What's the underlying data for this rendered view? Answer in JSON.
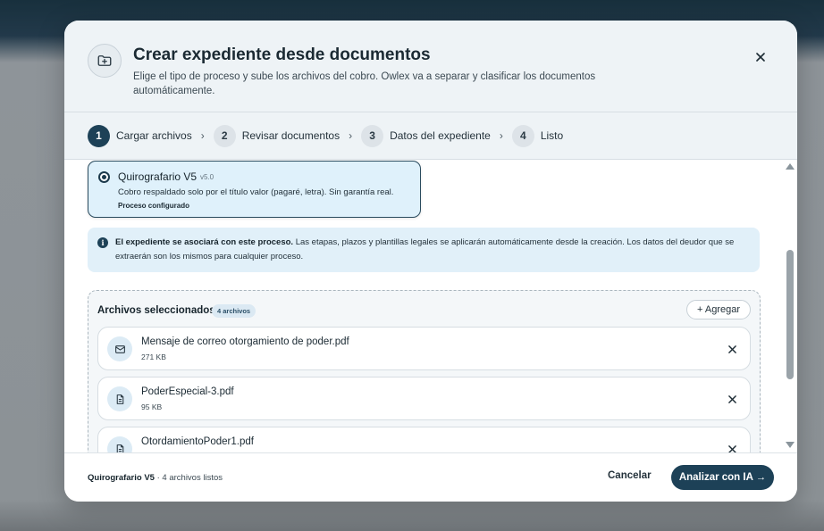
{
  "header": {
    "title": "Crear expediente desde documentos",
    "subtitle": "Elige el tipo de proceso y sube los archivos del cobro. Owlex va a separar y clasificar los documentos automáticamente.",
    "close_icon": "close-icon",
    "folder_icon": "folder-plus-icon"
  },
  "steps": [
    {
      "num": "1",
      "label": "Cargar archivos",
      "active": true
    },
    {
      "num": "2",
      "label": "Revisar documentos",
      "active": false
    },
    {
      "num": "3",
      "label": "Datos del expediente",
      "active": false
    },
    {
      "num": "4",
      "label": "Listo",
      "active": false
    }
  ],
  "step_separator": "›",
  "process": {
    "name": "Quirografario V5",
    "version": "v5.0",
    "description": "Cobro respaldado solo por el título valor (pagaré, letra). Sin garantía real.",
    "status": "Proceso configurado"
  },
  "info": {
    "icon": "i",
    "bold": "El expediente se asociará con este proceso.",
    "text": " Las etapas, plazos y plantillas legales se aplicarán automáticamente desde la creación. Los datos del deudor que se extraerán son los mismos para cualquier proceso."
  },
  "files": {
    "title": "Archivos seleccionados",
    "count": "4 archivos",
    "add_label": "+ Agregar",
    "items": [
      {
        "name": "Mensaje de correo otorgamiento de poder.pdf",
        "size": "271 KB",
        "icon": "mail-icon"
      },
      {
        "name": "PoderEspecial-3.pdf",
        "size": "95 KB",
        "icon": "document-icon"
      },
      {
        "name": "OtordamientoPoder1.pdf",
        "size": "",
        "icon": "document-icon"
      }
    ]
  },
  "footer": {
    "process_name": "Quirografario V5",
    "summary": " · 4 archivos listos",
    "cancel": "Cancelar",
    "analyze": "Analizar con IA →"
  },
  "colors": {
    "primary": "#1d4157",
    "selected_bg": "#dff1fb",
    "info_bg": "#e1f0f9"
  }
}
